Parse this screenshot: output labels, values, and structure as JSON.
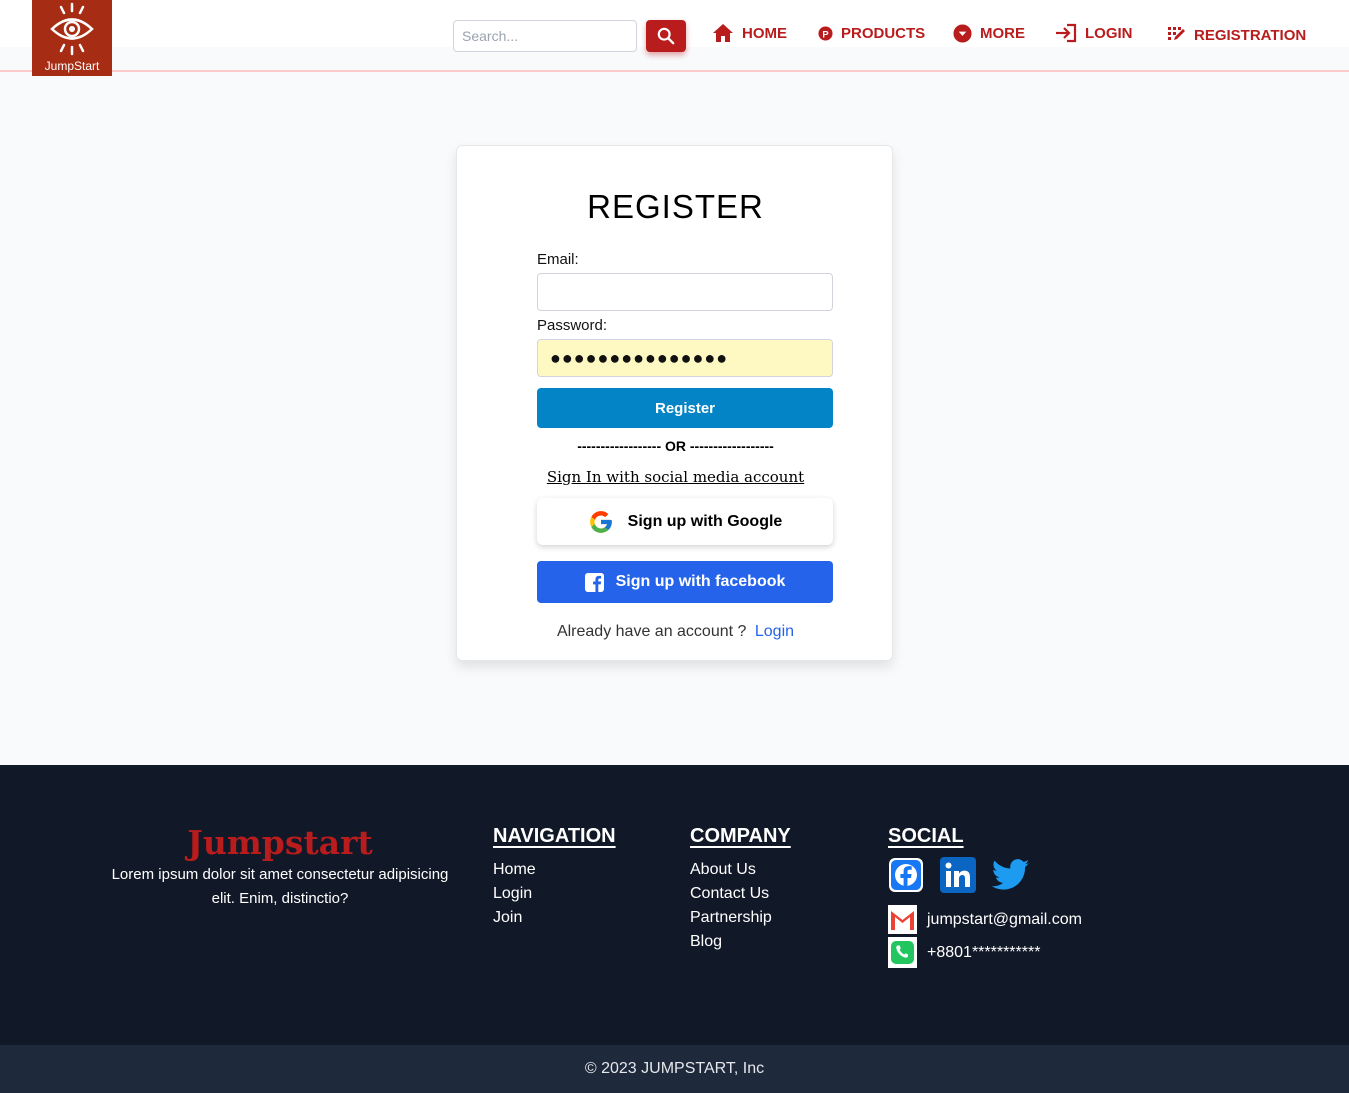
{
  "header": {
    "logo_text": "JumpStart",
    "search_placeholder": "Search...",
    "nav": [
      {
        "label": "HOME",
        "icon": "home-icon"
      },
      {
        "label": "PRODUCTS",
        "icon": "products-icon"
      },
      {
        "label": "MORE",
        "icon": "chevron-down-circle-icon"
      },
      {
        "label": "LOGIN",
        "icon": "login-icon"
      },
      {
        "label": "REGISTRATION",
        "icon": "registration-icon"
      }
    ]
  },
  "form": {
    "title": "REGISTER",
    "email_label": "Email:",
    "email_value": "",
    "password_label": "Password:",
    "password_value": "●●●●●●●●●●●●●●●",
    "register_label": "Register",
    "or_separator": "------------------ OR ------------------",
    "social_heading": "Sign In with social media account",
    "google_label": "Sign up with Google",
    "facebook_label": "Sign up with facebook",
    "have_account": "Already have an account ?",
    "login_link": "Login"
  },
  "footer": {
    "brand": "Jumpstart",
    "description": "Lorem ipsum dolor sit amet consectetur adipisicing elit. Enim, distinctio?",
    "navigation": {
      "title": "NAVIGATION",
      "items": [
        "Home",
        "Login",
        "Join"
      ]
    },
    "company": {
      "title": "COMPANY",
      "items": [
        "About Us",
        "Contact Us",
        "Partnership",
        "Blog"
      ]
    },
    "social": {
      "title": "SOCIAL",
      "icons": [
        "facebook-icon",
        "linkedin-icon",
        "twitter-icon"
      ]
    },
    "email": "jumpstart@gmail.com",
    "phone": "+8801***********",
    "copyright": "© 2023 JUMPSTART, Inc"
  },
  "colors": {
    "brand_red": "#b91c1c",
    "logo_bg": "#a62c14",
    "register_blue": "#0284c7",
    "facebook_blue": "#2563eb",
    "footer_bg": "#111827"
  }
}
